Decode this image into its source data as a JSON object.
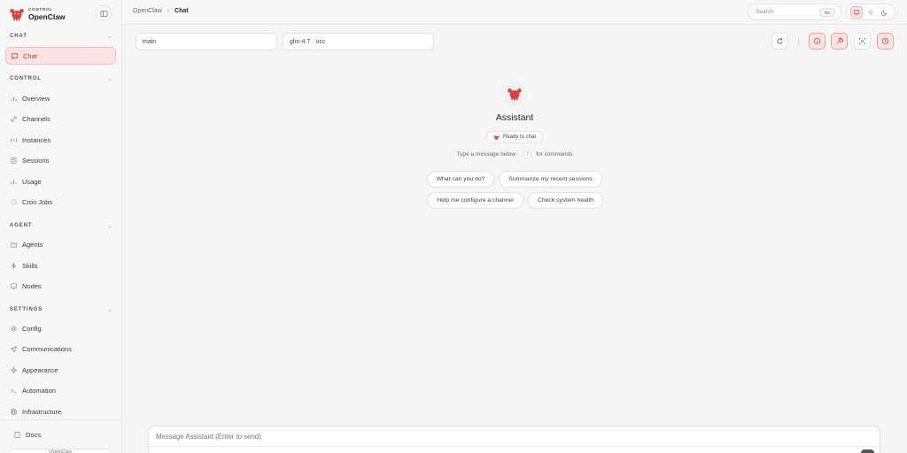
{
  "brand": {
    "small": "CONTROL",
    "name": "OpenClaw",
    "logo_icon": "lobster-logo-icon"
  },
  "sidebar": {
    "sections": [
      {
        "key": "chat",
        "label": "CHAT",
        "items": [
          {
            "label": "Chat",
            "icon": "chat-bubble-icon",
            "active": true
          }
        ]
      },
      {
        "key": "control",
        "label": "CONTROL",
        "items": [
          {
            "label": "Overview",
            "icon": "bar-chart-icon"
          },
          {
            "label": "Channels",
            "icon": "link-icon"
          },
          {
            "label": "Instances",
            "icon": "broadcast-icon"
          },
          {
            "label": "Sessions",
            "icon": "document-icon"
          },
          {
            "label": "Usage",
            "icon": "bar-chart-icon"
          },
          {
            "label": "Cron Jobs",
            "icon": "loader-icon"
          }
        ]
      },
      {
        "key": "agent",
        "label": "AGENT",
        "items": [
          {
            "label": "Agents",
            "icon": "folder-icon"
          },
          {
            "label": "Skills",
            "icon": "bolt-icon"
          },
          {
            "label": "Nodes",
            "icon": "monitor-icon"
          }
        ]
      },
      {
        "key": "settings",
        "label": "SETTINGS",
        "items": [
          {
            "label": "Config",
            "icon": "gear-icon"
          },
          {
            "label": "Communications",
            "icon": "send-icon"
          },
          {
            "label": "Appearance",
            "icon": "sparkle-icon"
          },
          {
            "label": "Automation",
            "icon": "terminal-icon"
          },
          {
            "label": "Infrastructure",
            "icon": "globe-icon"
          }
        ]
      }
    ],
    "docs_label": "Docs",
    "version_text": "vOpenClaw"
  },
  "topbar": {
    "breadcrumb_root": "OpenClaw",
    "breadcrumb_sep": "›",
    "breadcrumb_current": "Chat",
    "search_placeholder": "Search",
    "search_shortcut": "⌘K"
  },
  "controls": {
    "session_value": "main",
    "model_value": "glm-4.7 · occ"
  },
  "welcome": {
    "assistant_name": "Assistant",
    "status": "Ready to chat",
    "hint_before": "Type a message below ·",
    "hint_key": "/",
    "hint_after": "for commands",
    "suggestions": [
      "What can you do?",
      "Summarize my recent sessions",
      "Help me configure a channel",
      "Check system health"
    ]
  },
  "composer": {
    "placeholder": "Message Assistant (Enter to send)"
  },
  "colors": {
    "accent": "#d9433f",
    "accent_soft": "#fde4e4"
  }
}
